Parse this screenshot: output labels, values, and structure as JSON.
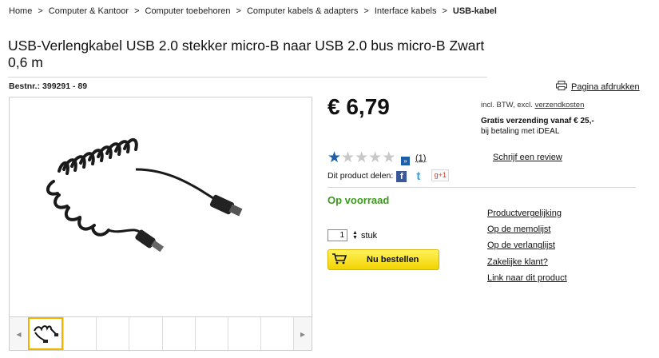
{
  "breadcrumb": {
    "items": [
      "Home",
      "Computer & Kantoor",
      "Computer toebehoren",
      "Computer kabels & adapters",
      "Interface kabels"
    ],
    "current": "USB-kabel",
    "separator": ">"
  },
  "product": {
    "title": "USB-Verlengkabel USB 2.0 stekker micro-B naar USB 2.0 bus micro-B Zwart 0,6 m",
    "bestnr": "Bestnr.: 399291 - 89"
  },
  "print": {
    "label": "Pagina afdrukken",
    "icon": "printer-icon"
  },
  "price": {
    "value": "€ 6,79"
  },
  "tax": {
    "prefix": "incl. BTW, excl.",
    "link": "verzendkosten"
  },
  "shipping": {
    "line1": "Gratis verzending vanaf € 25,-",
    "line2": "bij betaling met iDEAL"
  },
  "rating": {
    "stars_filled": 1,
    "stars_total": 5,
    "count": "(1)",
    "write_review": "Schrijf een review"
  },
  "share": {
    "label": "Dit product delen:",
    "gplus": "g+1"
  },
  "stock": {
    "status": "Op voorraad"
  },
  "quantity": {
    "value": "1",
    "unit": "stuk"
  },
  "buy": {
    "label": "Nu bestellen"
  },
  "links": [
    "Productvergelijking",
    "Op de memolijst",
    "Op de verlanglijst",
    "Zakelijke klant?",
    "Link naar dit product"
  ],
  "colors": {
    "accent_blue": "#1a5fa8",
    "stock_green": "#3a9a1a",
    "button_yellow": "#f2d300"
  }
}
